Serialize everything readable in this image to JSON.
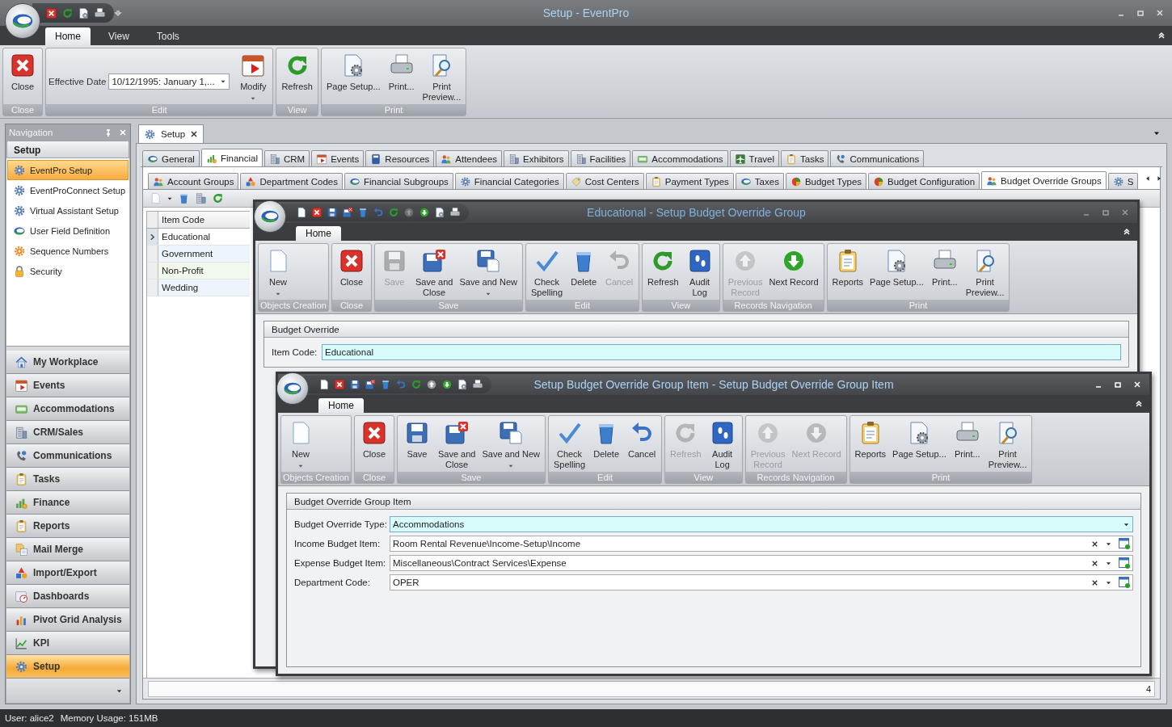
{
  "window": {
    "title": "Setup - EventPro"
  },
  "ribbon": {
    "tabs": [
      {
        "label": "Home",
        "selected": true
      },
      {
        "label": "View",
        "selected": false
      },
      {
        "label": "Tools",
        "selected": false
      }
    ],
    "groups": [
      {
        "label": "Close",
        "items": [
          {
            "kind": "close",
            "label": "Close",
            "menu": false
          }
        ]
      },
      {
        "label": "Edit",
        "items": [
          {
            "kind": "field",
            "label": "Effective Date",
            "value": "10/12/1995: January 1,..."
          },
          {
            "kind": "calendar",
            "label": "Modify",
            "menu": true
          }
        ]
      },
      {
        "label": "View",
        "items": [
          {
            "kind": "refresh",
            "label": "Refresh",
            "menu": false
          }
        ]
      },
      {
        "label": "Print",
        "items": [
          {
            "kind": "page-setup",
            "label": "Page Setup...",
            "menu": false
          },
          {
            "kind": "print",
            "label": "Print...",
            "menu": false
          },
          {
            "kind": "preview",
            "label": "Print\nPreview...",
            "menu": false
          }
        ]
      }
    ]
  },
  "navigation": {
    "title": "Navigation",
    "section": "Setup",
    "items": [
      {
        "label": "EventPro Setup",
        "kind": "gear",
        "selected": true
      },
      {
        "label": "EventProConnect Setup",
        "kind": "gear",
        "selected": false
      },
      {
        "label": "Virtual Assistant Setup",
        "kind": "gear",
        "selected": false
      },
      {
        "label": "User Field Definition",
        "kind": "logo",
        "selected": false
      },
      {
        "label": "Sequence Numbers",
        "kind": "sequence",
        "selected": false
      },
      {
        "label": "Security",
        "kind": "lock",
        "selected": false
      }
    ],
    "modules": [
      {
        "label": "My Workplace",
        "kind": "home",
        "selected": false
      },
      {
        "label": "Events",
        "kind": "calendar",
        "selected": false
      },
      {
        "label": "Accommodations",
        "kind": "bed",
        "selected": false
      },
      {
        "label": "CRM/Sales",
        "kind": "building",
        "selected": false
      },
      {
        "label": "Communications",
        "kind": "phone",
        "selected": false
      },
      {
        "label": "Tasks",
        "kind": "clipboard",
        "selected": false
      },
      {
        "label": "Finance",
        "kind": "finance",
        "selected": false
      },
      {
        "label": "Reports",
        "kind": "reports",
        "selected": false
      },
      {
        "label": "Mail Merge",
        "kind": "merge",
        "selected": false
      },
      {
        "label": "Import/Export",
        "kind": "import",
        "selected": false
      },
      {
        "label": "Dashboards",
        "kind": "dashboard",
        "selected": false
      },
      {
        "label": "Pivot Grid Analysis",
        "kind": "pivot",
        "selected": false
      },
      {
        "label": "KPI",
        "kind": "kpi",
        "selected": false
      },
      {
        "label": "Setup",
        "kind": "gear",
        "selected": true
      }
    ]
  },
  "document": {
    "tab": "Setup",
    "tabs": [
      {
        "label": "General",
        "kind": "logo",
        "selected": false
      },
      {
        "label": "Financial",
        "kind": "finance",
        "selected": true
      },
      {
        "label": "CRM",
        "kind": "building",
        "selected": false
      },
      {
        "label": "Events",
        "kind": "calendar",
        "selected": false
      },
      {
        "label": "Resources",
        "kind": "book",
        "selected": false
      },
      {
        "label": "Attendees",
        "kind": "people",
        "selected": false
      },
      {
        "label": "Exhibitors",
        "kind": "building",
        "selected": false
      },
      {
        "label": "Facilities",
        "kind": "building",
        "selected": false
      },
      {
        "label": "Accommodations",
        "kind": "bed",
        "selected": false
      },
      {
        "label": "Travel",
        "kind": "plane",
        "selected": false
      },
      {
        "label": "Tasks",
        "kind": "clipboard",
        "selected": false
      },
      {
        "label": "Communications",
        "kind": "phone",
        "selected": false
      }
    ],
    "subtabs": [
      {
        "label": "Account Groups",
        "kind": "people",
        "selected": false
      },
      {
        "label": "Department Codes",
        "kind": "import",
        "selected": false
      },
      {
        "label": "Financial Subgroups",
        "kind": "logo",
        "selected": false
      },
      {
        "label": "Financial Categories",
        "kind": "gear",
        "selected": false
      },
      {
        "label": "Cost Centers",
        "kind": "tag",
        "selected": false
      },
      {
        "label": "Payment Types",
        "kind": "reports",
        "selected": false
      },
      {
        "label": "Taxes",
        "kind": "logo",
        "selected": false
      },
      {
        "label": "Budget Types",
        "kind": "pie",
        "selected": false
      },
      {
        "label": "Budget Configuration",
        "kind": "pie",
        "selected": false
      },
      {
        "label": "Budget Override Groups",
        "kind": "people",
        "selected": true
      },
      {
        "label": "S",
        "kind": "gear",
        "selected": false
      }
    ],
    "grid": {
      "column": "Item Code",
      "rows": [
        {
          "label": "Educational",
          "selected": true
        },
        {
          "label": "Government",
          "selected": false
        },
        {
          "label": "Non-Profit",
          "selected": false
        },
        {
          "label": "Wedding",
          "selected": false
        }
      ]
    },
    "count": "4"
  },
  "dialogs": [
    {
      "title": "Educational - Setup Budget Override Group",
      "active": false,
      "tabs": [
        {
          "label": "Home",
          "selected": true
        }
      ],
      "groups": [
        {
          "label": "Objects Creation",
          "items": [
            {
              "kind": "new",
              "label": "New",
              "menu": true,
              "disabled": false
            }
          ]
        },
        {
          "label": "Close",
          "items": [
            {
              "kind": "close",
              "label": "Close",
              "menu": false,
              "disabled": false
            }
          ]
        },
        {
          "label": "Save",
          "items": [
            {
              "kind": "save",
              "label": "Save",
              "menu": false,
              "disabled": true
            },
            {
              "kind": "save-close",
              "label": "Save and\nClose",
              "menu": false,
              "disabled": false
            },
            {
              "kind": "save-new",
              "label": "Save and New",
              "menu": true,
              "disabled": false
            }
          ]
        },
        {
          "label": "Edit",
          "items": [
            {
              "kind": "spell",
              "label": "Check\nSpelling",
              "menu": false,
              "disabled": false
            },
            {
              "kind": "delete",
              "label": "Delete",
              "menu": false,
              "disabled": false
            },
            {
              "kind": "cancel",
              "label": "Cancel",
              "menu": false,
              "disabled": true
            }
          ]
        },
        {
          "label": "View",
          "items": [
            {
              "kind": "refresh",
              "label": "Refresh",
              "menu": false,
              "disabled": false
            },
            {
              "kind": "audit",
              "label": "Audit\nLog",
              "menu": false,
              "disabled": false
            }
          ]
        },
        {
          "label": "Records Navigation",
          "items": [
            {
              "kind": "prev",
              "label": "Previous\nRecord",
              "menu": false,
              "disabled": true
            },
            {
              "kind": "next",
              "label": "Next Record",
              "menu": false,
              "disabled": false
            }
          ]
        },
        {
          "label": "Print",
          "items": [
            {
              "kind": "reports",
              "label": "Reports",
              "menu": false,
              "disabled": false
            },
            {
              "kind": "page-setup",
              "label": "Page Setup...",
              "menu": false,
              "disabled": false
            },
            {
              "kind": "print",
              "label": "Print...",
              "menu": false,
              "disabled": false
            },
            {
              "kind": "preview",
              "label": "Print\nPreview...",
              "menu": false,
              "disabled": false
            }
          ]
        }
      ],
      "sections": [
        {
          "title": "Budget Override",
          "fields": [
            {
              "label": "Item Code:",
              "value": "Educational",
              "kind": "text",
              "focused": true
            }
          ]
        }
      ]
    },
    {
      "title": "Setup Budget Override Group Item - Setup Budget Override Group Item",
      "active": true,
      "tabs": [
        {
          "label": "Home",
          "selected": true
        }
      ],
      "groups": [
        {
          "label": "Objects Creation",
          "items": [
            {
              "kind": "new",
              "label": "New",
              "menu": true,
              "disabled": false
            }
          ]
        },
        {
          "label": "Close",
          "items": [
            {
              "kind": "close",
              "label": "Close",
              "menu": false,
              "disabled": false
            }
          ]
        },
        {
          "label": "Save",
          "items": [
            {
              "kind": "save",
              "label": "Save",
              "menu": false,
              "disabled": false
            },
            {
              "kind": "save-close",
              "label": "Save and\nClose",
              "menu": false,
              "disabled": false
            },
            {
              "kind": "save-new",
              "label": "Save and New",
              "menu": true,
              "disabled": false
            }
          ]
        },
        {
          "label": "Edit",
          "items": [
            {
              "kind": "spell",
              "label": "Check\nSpelling",
              "menu": false,
              "disabled": false
            },
            {
              "kind": "delete",
              "label": "Delete",
              "menu": false,
              "disabled": false
            },
            {
              "kind": "cancel",
              "label": "Cancel",
              "menu": false,
              "disabled": false
            }
          ]
        },
        {
          "label": "View",
          "items": [
            {
              "kind": "refresh",
              "label": "Refresh",
              "menu": false,
              "disabled": true
            },
            {
              "kind": "audit",
              "label": "Audit\nLog",
              "menu": false,
              "disabled": false
            }
          ]
        },
        {
          "label": "Records Navigation",
          "items": [
            {
              "kind": "prev",
              "label": "Previous\nRecord",
              "menu": false,
              "disabled": true
            },
            {
              "kind": "next",
              "label": "Next Record",
              "menu": false,
              "disabled": true
            }
          ]
        },
        {
          "label": "Print",
          "items": [
            {
              "kind": "reports",
              "label": "Reports",
              "menu": false,
              "disabled": false
            },
            {
              "kind": "page-setup",
              "label": "Page Setup...",
              "menu": false,
              "disabled": false
            },
            {
              "kind": "print",
              "label": "Print...",
              "menu": false,
              "disabled": false
            },
            {
              "kind": "preview",
              "label": "Print\nPreview...",
              "menu": false,
              "disabled": false
            }
          ]
        }
      ],
      "sections": [
        {
          "title": "Budget Override Group Item",
          "fields": [
            {
              "label": "Budget Override Type:",
              "value": "Accommodations",
              "kind": "dropdown",
              "focused": true
            },
            {
              "label": "Income Budget Item:",
              "value": "Room Rental Revenue\\Income-Setup\\Income",
              "kind": "lookup",
              "focused": false
            },
            {
              "label": "Expense Budget Item:",
              "value": "Miscellaneous\\Contract Services\\Expense",
              "kind": "lookup",
              "focused": false
            },
            {
              "label": "Department Code:",
              "value": "OPER",
              "kind": "lookup",
              "focused": false
            }
          ]
        }
      ]
    }
  ],
  "status_bar": [
    "User: alice2",
    "Memory Usage: 151MB"
  ]
}
